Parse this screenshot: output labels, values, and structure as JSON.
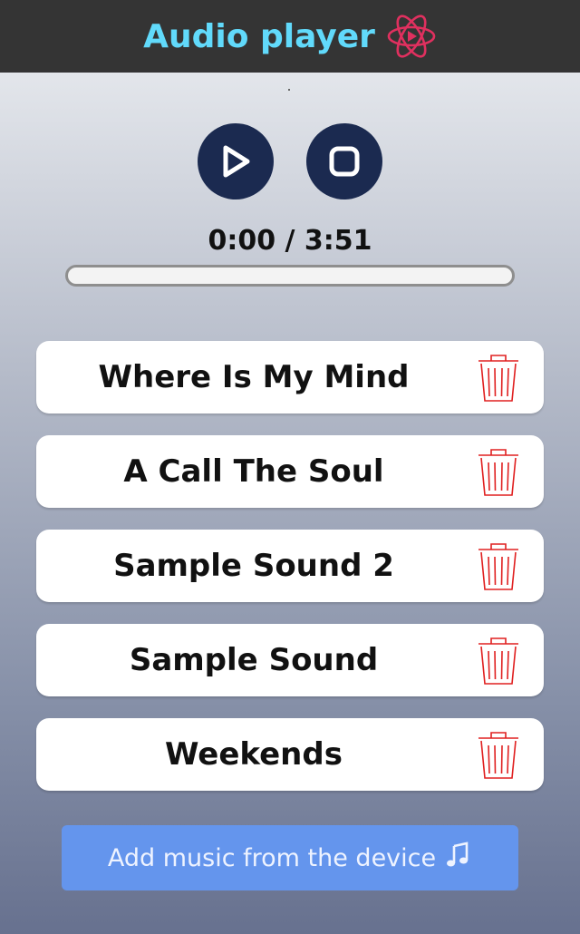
{
  "app": {
    "title": "Audio player",
    "accent": "#61dafb",
    "logo_color": "#e0305f",
    "icon": "react-atom-icon"
  },
  "player": {
    "play_icon": "play-icon",
    "stop_icon": "stop-icon",
    "current_time": "0:00",
    "duration": "3:51",
    "time_display": "0:00 / 3:51",
    "progress": 0
  },
  "tracks": [
    {
      "title": "Where Is My Mind",
      "delete_icon": "trash-icon"
    },
    {
      "title": "A Call The Soul",
      "delete_icon": "trash-icon"
    },
    {
      "title": "Sample Sound 2",
      "delete_icon": "trash-icon"
    },
    {
      "title": "Sample Sound",
      "delete_icon": "trash-icon"
    },
    {
      "title": "Weekends",
      "delete_icon": "trash-icon"
    }
  ],
  "add_button": {
    "label": "Add music from the device",
    "icon": "music-note-icon",
    "color": "#6495ed"
  }
}
